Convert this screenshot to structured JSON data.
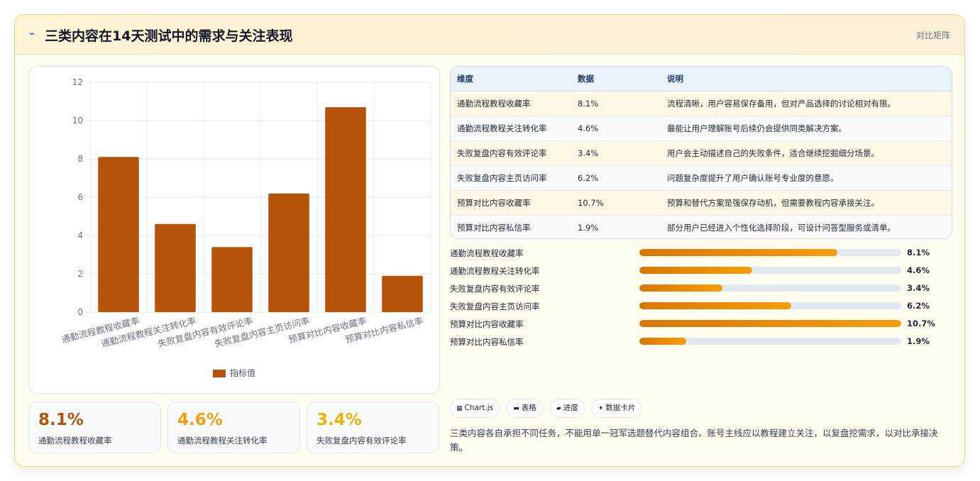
{
  "header": {
    "icon": "lightning-icon",
    "title": "三类内容在14天测试中的需求与关注表现",
    "tag": "对比矩阵"
  },
  "chart_data": {
    "type": "bar",
    "categories": [
      "通勤流程教程收藏率",
      "通勤流程教程关注转化率",
      "失败复盘内容有效评论率",
      "失败复盘内容主页访问率",
      "预算对比内容收藏率",
      "预算对比内容私信率"
    ],
    "series": [
      {
        "name": "指标值",
        "values": [
          8.1,
          4.6,
          3.4,
          6.2,
          10.7,
          1.9
        ]
      }
    ],
    "ylim": [
      0,
      12
    ],
    "yticks": [
      0,
      2,
      4,
      6,
      8,
      10,
      12
    ],
    "grid": true,
    "legend": "bottom",
    "bar_color": "#b45309"
  },
  "stats": [
    {
      "value": "8.1%",
      "label": "通勤流程教程收藏率",
      "color": "#b45309"
    },
    {
      "value": "4.6%",
      "label": "通勤流程教程关注转化率",
      "color": "#f59e0b"
    },
    {
      "value": "3.4%",
      "label": "失败复盘内容有效评论率",
      "color": "#eab308"
    }
  ],
  "table": {
    "headers": [
      "维度",
      "数据",
      "说明"
    ],
    "rows": [
      [
        "通勤流程教程收藏率",
        "8.1%",
        "流程清晰，用户容易保存备用，但对产品选择的讨论相对有限。"
      ],
      [
        "通勤流程教程关注转化率",
        "4.6%",
        "最能让用户理解账号后续仍会提供同类解决方案。"
      ],
      [
        "失败复盘内容有效评论率",
        "3.4%",
        "用户会主动描述自己的失败条件，适合继续挖掘细分场景。"
      ],
      [
        "失败复盘内容主页访问率",
        "6.2%",
        "问题复杂度提升了用户确认账号专业度的意愿。"
      ],
      [
        "预算对比内容收藏率",
        "10.7%",
        "预算和替代方案是强保存动机，但需要教程内容承接关注。"
      ],
      [
        "预算对比内容私信率",
        "1.9%",
        "部分用户已经进入个性化选择阶段，可设计问答型服务或清单。"
      ]
    ]
  },
  "progress": {
    "max": 10.7,
    "items": [
      {
        "label": "通勤流程教程收藏率",
        "value": 8.1,
        "display": "8.1%"
      },
      {
        "label": "通勤流程教程关注转化率",
        "value": 4.6,
        "display": "4.6%"
      },
      {
        "label": "失败复盘内容有效评论率",
        "value": 3.4,
        "display": "3.4%"
      },
      {
        "label": "失败复盘内容主页访问率",
        "value": 6.2,
        "display": "6.2%"
      },
      {
        "label": "预算对比内容收藏率",
        "value": 10.7,
        "display": "10.7%"
      },
      {
        "label": "预算对比内容私信率",
        "value": 1.9,
        "display": "1.9%"
      }
    ]
  },
  "chips": [
    {
      "icon": "chart-icon",
      "glyph": "▦",
      "label": "Chart.js"
    },
    {
      "icon": "table-icon",
      "glyph": "▬",
      "label": "表格"
    },
    {
      "icon": "progress-icon",
      "glyph": "▰",
      "label": "进度"
    },
    {
      "icon": "sparkle-icon",
      "glyph": "✦",
      "label": "数据卡片"
    }
  ],
  "summary": "三类内容各自承担不同任务，不能用单一冠军选题替代内容组合。账号主线应以教程建立关注，以复盘挖需求，以对比承接决策。"
}
